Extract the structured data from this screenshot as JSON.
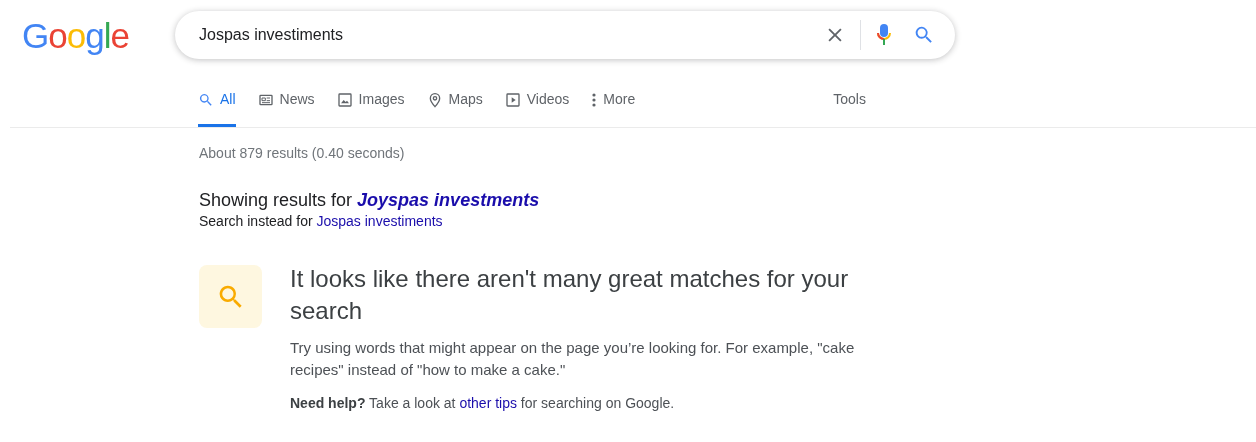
{
  "logo": "Google",
  "search": {
    "value": "Jospas investiments"
  },
  "tabs": [
    {
      "label": "All",
      "kind": "search",
      "selected": true
    },
    {
      "label": "News",
      "kind": "news",
      "selected": false
    },
    {
      "label": "Images",
      "kind": "images",
      "selected": false
    },
    {
      "label": "Maps",
      "kind": "maps",
      "selected": false
    },
    {
      "label": "Videos",
      "kind": "videos",
      "selected": false
    },
    {
      "label": "More",
      "kind": "more",
      "selected": false
    }
  ],
  "tools": "Tools",
  "result_stats": "About 879 results (0.40 seconds)",
  "correction": {
    "showing_prefix": "Showing results for ",
    "corrected_query": "Joyspas investments",
    "instead_prefix": "Search instead for ",
    "original_query": "Jospas investiments"
  },
  "no_results": {
    "heading": "It looks like there aren't many great matches for your search",
    "tip": "Try using words that might appear on the page you’re looking for. For example, \"cake recipes\" instead of \"how to make a cake.\"",
    "help_before": "**Need help?** Take a look at ",
    "help_link": "other tips",
    "help_after": " for searching on Google."
  }
}
